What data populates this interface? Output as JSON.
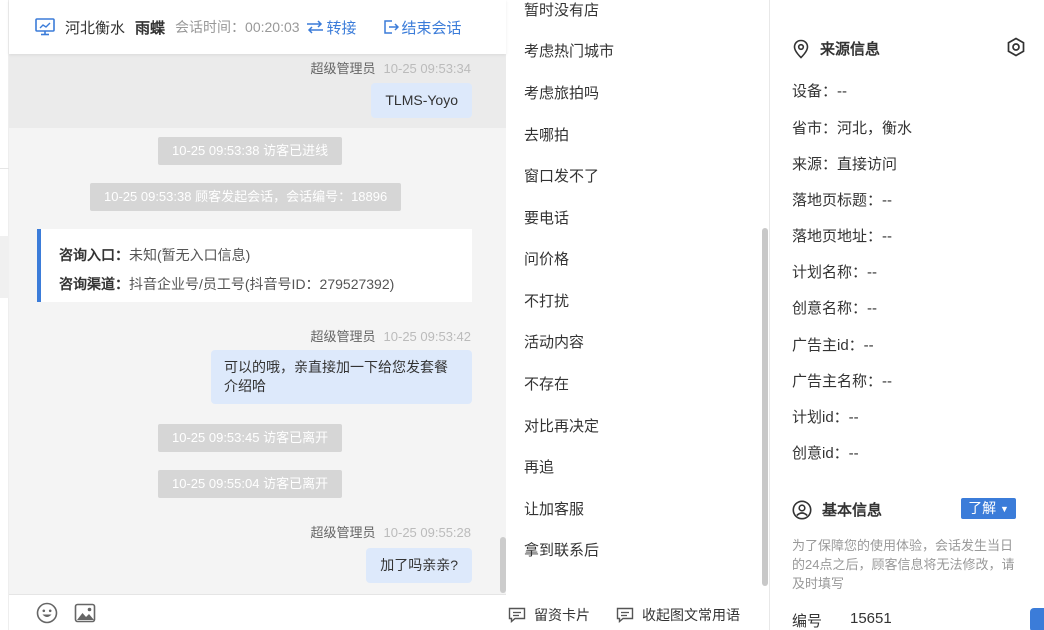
{
  "header": {
    "location": "河北衡水",
    "visitor_name": "雨蝶",
    "session_time_label": "会话时间：",
    "session_time_value": "00:20:03",
    "transfer_label": "转接",
    "end_label": "结束会话"
  },
  "messages": {
    "m1_sender": "超级管理员",
    "m1_time": "10-25 09:53:34",
    "m1_text": "TLMS-Yoyo",
    "sys1": "10-25 09:53:38 访客已进线",
    "sys2": "10-25 09:53:38 顾客发起会话，会话编号：18896",
    "card_entry_label": "咨询入口：",
    "card_entry_value": "未知(暂无入口信息)",
    "card_channel_label": "咨询渠道：",
    "card_channel_value": "抖音企业号/员工号(抖音号ID：279527392)",
    "m2_sender": "超级管理员",
    "m2_time": "10-25 09:53:42",
    "m2_line1": "可以的哦，亲直接加一下给您发套餐",
    "m2_line2": "介绍哈",
    "sys3": "10-25 09:53:45 访客已离开",
    "sys4": "10-25 09:55:04 访客已离开",
    "m3_sender": "超级管理员",
    "m3_time": "10-25 09:55:28",
    "m3_text": "加了吗亲亲?"
  },
  "phrases": {
    "items": [
      "暂时没有店",
      "考虑热门城市",
      "考虑旅拍吗",
      "去哪拍",
      "窗口发不了",
      "要电话",
      "问价格",
      "不打扰",
      "活动内容",
      "不存在",
      "对比再决定",
      "再追",
      "让加客服",
      "拿到联系后"
    ],
    "footer_card": "留资卡片",
    "footer_collapse": "收起图文常用语"
  },
  "source_info": {
    "title": "来源信息",
    "fields": [
      "设备：--",
      "省市：河北，衡水",
      "来源：直接访问",
      "落地页标题：--",
      "落地页地址：--",
      "计划名称：--",
      "创意名称：--",
      "广告主id：--",
      "广告主名称：--",
      "计划id：--",
      "创意id：--"
    ]
  },
  "basic_info": {
    "title": "基本信息",
    "learn_label": "了解",
    "note": "为了保障您的使用体验，会话发生当日的24点之后，顾客信息将无法修改，请及时填写",
    "number_label": "编号",
    "number_value": "15651"
  },
  "colors": {
    "accent": "#3b7cd9",
    "bubble": "#dde9fb",
    "system_msg": "#d6d6d6"
  }
}
